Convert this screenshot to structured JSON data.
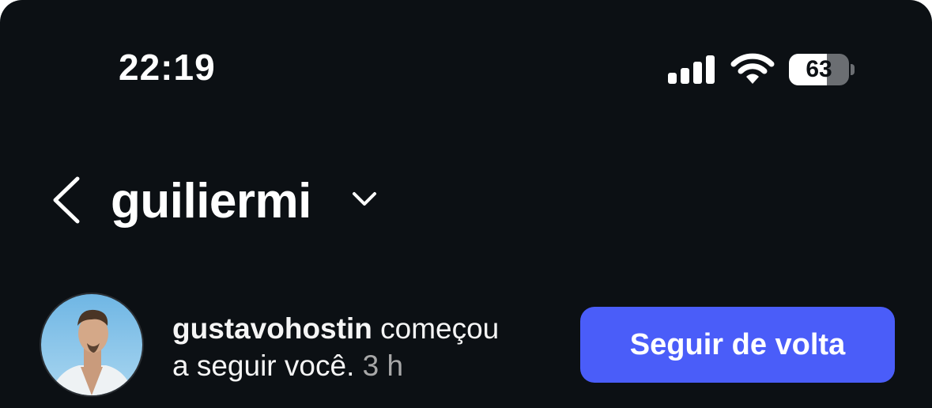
{
  "status_bar": {
    "time": "22:19",
    "battery_level": "63",
    "battery_fraction": 0.63
  },
  "header": {
    "username": "guiliermi"
  },
  "notification": {
    "username": "gustavohostin",
    "message_part1": "começou",
    "message_part2": "a seguir você.",
    "time_ago": "3 h",
    "follow_back_label": "Seguir de volta"
  },
  "colors": {
    "background": "#0c1014",
    "button": "#4a5df9",
    "muted_text": "#a8a8a8"
  },
  "icons": [
    "signal-icon",
    "wifi-icon",
    "battery-icon",
    "back-chevron-icon",
    "chevron-down-icon"
  ]
}
